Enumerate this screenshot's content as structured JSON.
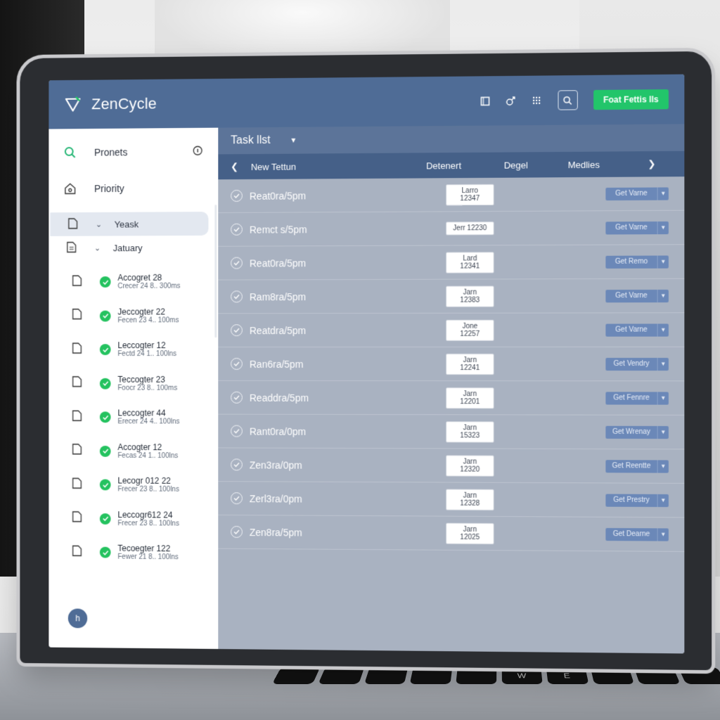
{
  "app": {
    "brand": "ZenCycle",
    "cta_label": "Foat Fettis lls"
  },
  "colors": {
    "topbar": "#4f6c96",
    "accent_green": "#22c56a",
    "table_bg": "#a9b2c1"
  },
  "topbar_icons": [
    "square-icon",
    "share-icon",
    "grid-icon",
    "search-icon"
  ],
  "sidebar": {
    "nav": [
      {
        "label": "Pronets",
        "icon": "search-icon"
      },
      {
        "label": "Priority",
        "icon": "home-icon"
      }
    ],
    "selected": "Yeask",
    "month": "Jatuary",
    "projects": [
      {
        "title": "Accogret 28",
        "sub": "Crecer 24 8.. 300ms"
      },
      {
        "title": "Jeccogter 22",
        "sub": "Fecen 23 4.. 100ms"
      },
      {
        "title": "Leccogter 12",
        "sub": "Fectd 24 1.. 100lns"
      },
      {
        "title": "Teccogter 23",
        "sub": "Foocr 23 8.. 100ms"
      },
      {
        "title": "Leccogter 44",
        "sub": "Erecer 24 4.. 100lns"
      },
      {
        "title": "Accogter 12",
        "sub": "Fecas 24 1.. 100lns"
      },
      {
        "title": "Lecogr 012 22",
        "sub": "Frecer 23 8.. 100lns"
      },
      {
        "title": "Leccogr612 24",
        "sub": "Frecer 23 8.. 100lns"
      },
      {
        "title": "Tecoegter 122",
        "sub": "Fewer 21 8.. 100lns"
      }
    ],
    "avatar": "h"
  },
  "main": {
    "title": "Task llst",
    "columns": {
      "c1": "New Tettun",
      "c2": "Detenert",
      "c3": "Degel",
      "c4": "Medlies"
    },
    "rows": [
      {
        "name": "Reat0ra/5pm",
        "date": "Larro 12347",
        "action": "Get Varne"
      },
      {
        "name": "Remct s/5pm",
        "date": "Jerr 12230",
        "action": "Get Varne"
      },
      {
        "name": "Reat0ra/5pm",
        "date": "Lard 12341",
        "action": "Get Remo"
      },
      {
        "name": "Ram8ra/5pm",
        "date": "Jarn 12383",
        "action": "Get Varne"
      },
      {
        "name": "Reatdra/5pm",
        "date": "Jone 12257",
        "action": "Get Varne"
      },
      {
        "name": "Ran6ra/5pm",
        "date": "Jarn 12241",
        "action": "Get Vendry"
      },
      {
        "name": "Readdra/5pm",
        "date": "Jarn 12201",
        "action": "Get Fennre"
      },
      {
        "name": "Rant0ra/0pm",
        "date": "Jarn 15323",
        "action": "Get Wrenay"
      },
      {
        "name": "Zen3ra/0pm",
        "date": "Jarn 12320",
        "action": "Get Reentte"
      },
      {
        "name": "Zerl3ra/0pm",
        "date": "Jarn 12328",
        "action": "Get Prestry"
      },
      {
        "name": "Zen8ra/5pm",
        "date": "Jarn 12025",
        "action": "Get Dearne"
      }
    ]
  },
  "keyboard": {
    "keys": [
      "",
      "",
      "",
      "",
      "",
      "W",
      "E",
      "",
      "",
      ""
    ]
  }
}
